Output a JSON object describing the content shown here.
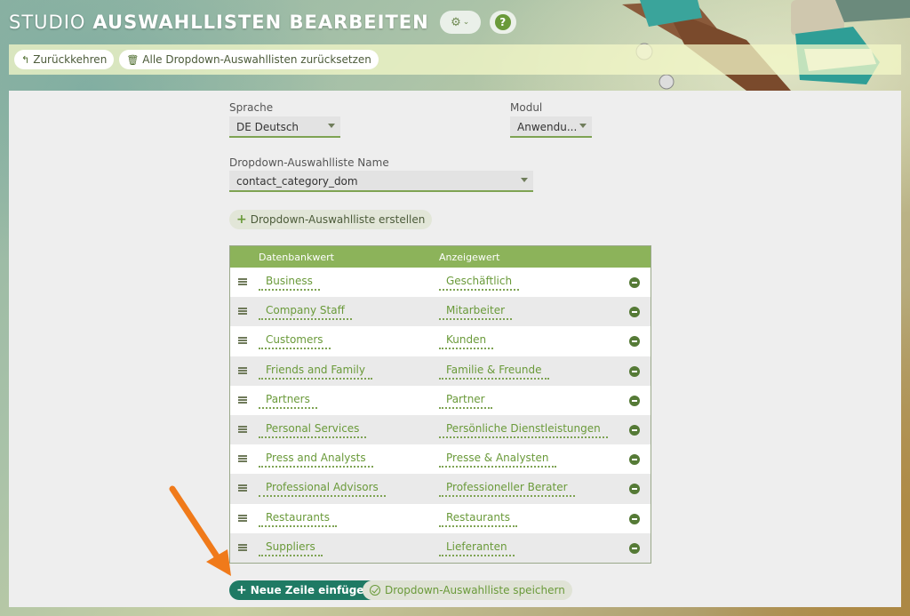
{
  "header": {
    "title_light": "STUDIO",
    "title_bold": "AUSWAHLLISTEN BEARBEITEN",
    "help_label": "?"
  },
  "toolbar": {
    "back_label": "Zurückkehren",
    "reset_label": "Alle Dropdown-Auswahllisten zurücksetzen"
  },
  "form": {
    "language_label": "Sprache",
    "language_value": "DE Deutsch",
    "module_label": "Modul",
    "module_value": "Anwendu...",
    "list_name_label": "Dropdown-Auswahlliste Name",
    "list_name_value": "contact_category_dom",
    "create_label": "Dropdown-Auswahlliste erstellen"
  },
  "table": {
    "columns": [
      "Datenbankwert",
      "Anzeigewert"
    ],
    "rows": [
      {
        "db": "Business",
        "display": "Geschäftlich"
      },
      {
        "db": "Company Staff",
        "display": "Mitarbeiter"
      },
      {
        "db": "Customers",
        "display": "Kunden"
      },
      {
        "db": "Friends and Family",
        "display": "Familie & Freunde"
      },
      {
        "db": "Partners",
        "display": "Partner"
      },
      {
        "db": "Personal Services",
        "display": "Persönliche Dienstleistungen"
      },
      {
        "db": "Press and Analysts",
        "display": "Presse & Analysten"
      },
      {
        "db": "Professional Advisors",
        "display": "Professioneller Berater"
      },
      {
        "db": "Restaurants",
        "display": "Restaurants"
      },
      {
        "db": "Suppliers",
        "display": "Lieferanten"
      }
    ]
  },
  "actions": {
    "add_row_label": "Neue Zeile einfügen",
    "save_label": "Dropdown-Auswahlliste speichern"
  },
  "colors": {
    "accent_green": "#8cb35a",
    "primary_button": "#1f7a64",
    "annotation_arrow": "#f07a1a"
  }
}
